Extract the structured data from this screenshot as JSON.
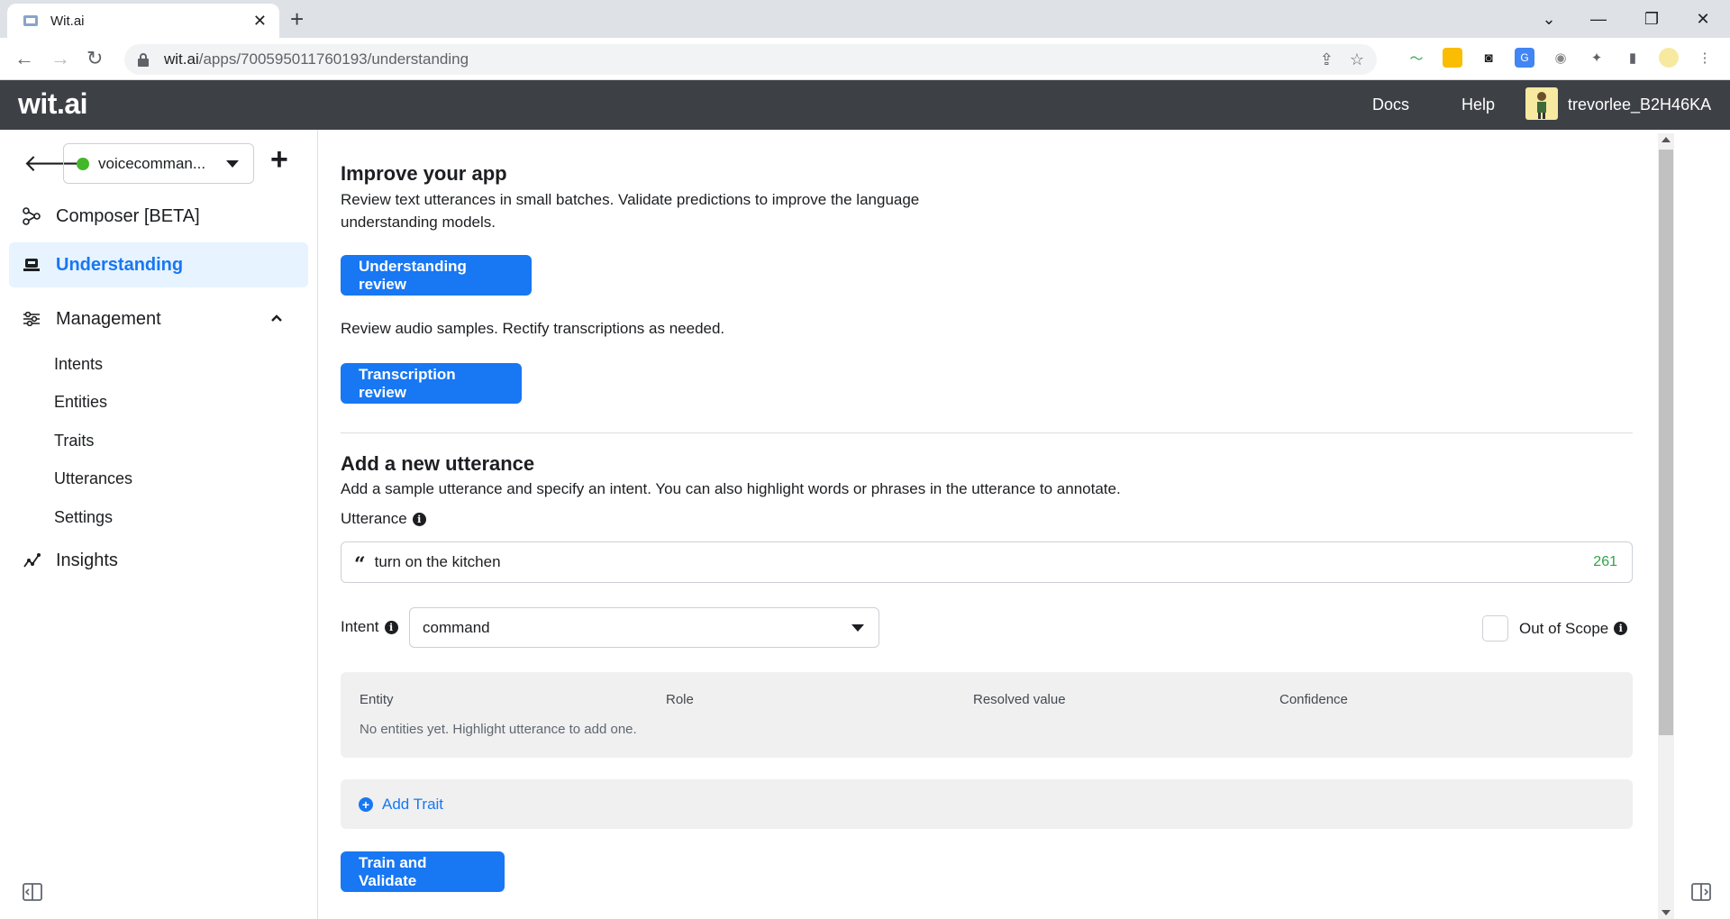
{
  "browser": {
    "tab_title": "Wit.ai",
    "url_host": "wit.ai",
    "url_path": "/apps/700595011760193/understanding"
  },
  "header": {
    "logo": "wit.ai",
    "docs": "Docs",
    "help": "Help",
    "username": "trevorlee_B2H46KA"
  },
  "sidebar": {
    "app_name": "voicecomman...",
    "items": [
      {
        "label": "Composer [BETA]",
        "icon": "composer-icon"
      },
      {
        "label": "Understanding",
        "icon": "understanding-icon"
      },
      {
        "label": "Management",
        "icon": "management-icon"
      },
      {
        "label": "Insights",
        "icon": "insights-icon"
      }
    ],
    "subitems": [
      "Intents",
      "Entities",
      "Traits",
      "Utterances",
      "Settings"
    ]
  },
  "main": {
    "improve_title": "Improve your app",
    "improve_desc": "Review text utterances in small batches. Validate predictions to improve the language understanding models.",
    "understanding_review": "Understanding review",
    "audio_desc": "Review audio samples. Rectify transcriptions as needed.",
    "transcription_review": "Transcription review",
    "add_title": "Add a new utterance",
    "add_desc": "Add a sample utterance and specify an intent. You can also highlight words or phrases in the utterance to annotate.",
    "utterance_label": "Utterance",
    "utterance_value": "turn on the kitchen",
    "char_count": "261",
    "intent_label": "Intent",
    "intent_value": "command",
    "out_of_scope": "Out of Scope",
    "entity_columns": [
      "Entity",
      "Role",
      "Resolved value",
      "Confidence"
    ],
    "entities_empty": "No entities yet. Highlight utterance to add one.",
    "add_trait": "Add Trait",
    "train_button": "Train and Validate"
  },
  "colors": {
    "accent": "#1877f2",
    "header_bg": "#3d4045",
    "active_bg": "#e7f3ff",
    "status_green": "#42b72a"
  }
}
